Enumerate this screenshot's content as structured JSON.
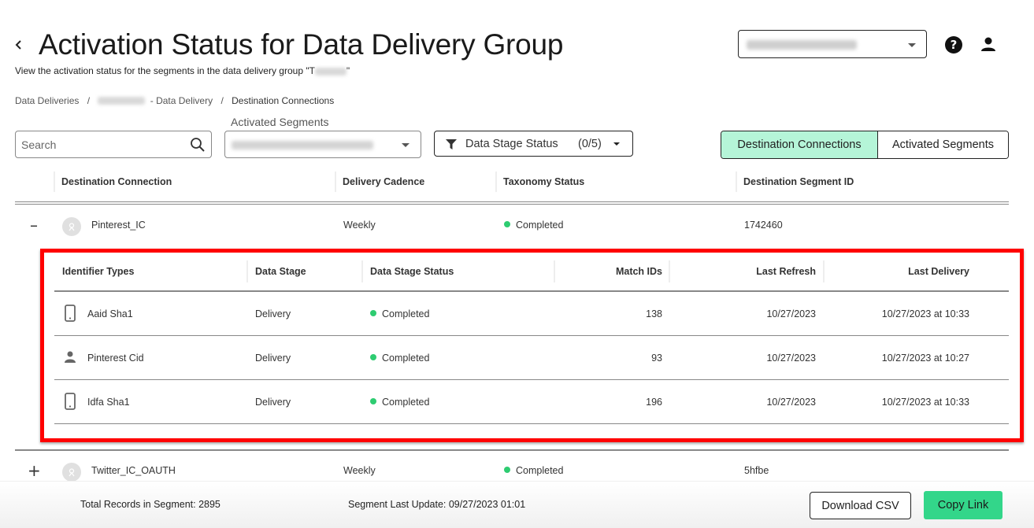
{
  "header": {
    "back_icon": "chevron-left-icon",
    "title": "Activation Status for Data Delivery Group",
    "subtitle_prefix": "View the activation status for the segments in the data delivery group \"T",
    "subtitle_suffix": "\"",
    "org_select_value": "[redacted]",
    "help_icon": "help-circle-icon",
    "help_glyph": "?",
    "user_icon": "person-icon"
  },
  "breadcrumb": {
    "items": [
      {
        "label": "Data Deliveries"
      },
      {
        "label": "- Data Delivery"
      },
      {
        "label": "Destination Connections"
      }
    ],
    "separator": "/"
  },
  "toolbar": {
    "search_placeholder": "Search",
    "search_value": "",
    "segments_label": "Activated Segments",
    "segments_value": "[redacted]",
    "filter_label": "Data Stage Status",
    "filter_count": "(0/5)",
    "view_toggle": [
      {
        "label": "Destination Connections",
        "active": true
      },
      {
        "label": "Activated Segments",
        "active": false
      }
    ]
  },
  "main_table": {
    "columns": [
      "Destination Connection",
      "Delivery Cadence",
      "Taxonomy Status",
      "Destination Segment ID"
    ],
    "rows": [
      {
        "expander": "–",
        "expanded": true,
        "name": "Pinterest_IC",
        "cadence": "Weekly",
        "taxonomy_status": "Completed",
        "segment_id": "1742460"
      },
      {
        "expander": "+",
        "expanded": false,
        "name": "Twitter_IC_OAUTH",
        "cadence": "Weekly",
        "taxonomy_status": "Completed",
        "segment_id": "5hfbe"
      }
    ]
  },
  "detail_table": {
    "columns": [
      "Identifier Types",
      "Data Stage",
      "Data Stage Status",
      "Match IDs",
      "Last Refresh",
      "Last Delivery"
    ],
    "rows": [
      {
        "icon": "mobile-phone-icon",
        "identifier": "Aaid Sha1",
        "stage": "Delivery",
        "status": "Completed",
        "match_ids": "138",
        "last_refresh": "10/27/2023",
        "last_delivery": "10/27/2023 at 10:33"
      },
      {
        "icon": "person-icon",
        "identifier": "Pinterest Cid",
        "stage": "Delivery",
        "status": "Completed",
        "match_ids": "93",
        "last_refresh": "10/27/2023",
        "last_delivery": "10/27/2023 at 10:27"
      },
      {
        "icon": "mobile-phone-icon",
        "identifier": "Idfa Sha1",
        "stage": "Delivery",
        "status": "Completed",
        "match_ids": "196",
        "last_refresh": "10/27/2023",
        "last_delivery": "10/27/2023 at 10:33"
      }
    ]
  },
  "footer": {
    "total_records": "Total Records in Segment: 2895",
    "last_update": "Segment Last Update: 09/27/2023 01:01",
    "download_label": "Download CSV",
    "copy_label": "Copy Link"
  },
  "colors": {
    "status_completed": "#2ecc71",
    "active_toggle_bg": "#b5f5d8",
    "primary_button": "#33d68a",
    "highlight_border": "#ff0000"
  }
}
